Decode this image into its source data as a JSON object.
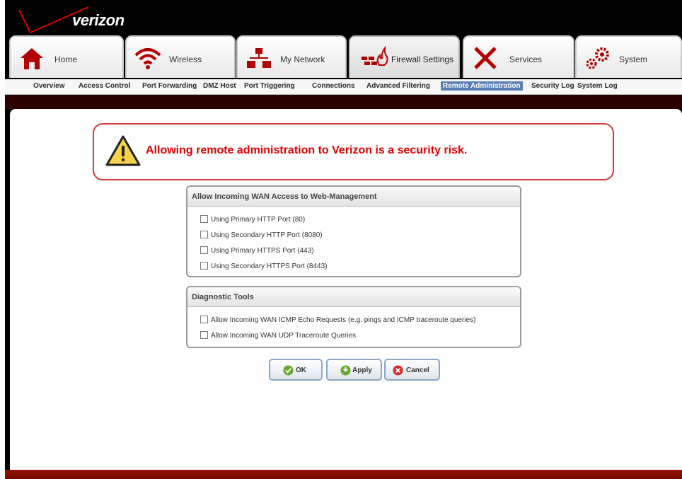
{
  "brand": {
    "logo_text": "verizon"
  },
  "tabs": [
    {
      "label": "Home",
      "icon": "home-icon"
    },
    {
      "label": "Wireless",
      "icon": "wifi-icon"
    },
    {
      "label": "My Network",
      "icon": "network-icon"
    },
    {
      "label": "Firewall Settings",
      "icon": "firewall-icon",
      "active": true
    },
    {
      "label": "Services",
      "icon": "tools-icon"
    },
    {
      "label": "System",
      "icon": "gears-icon"
    }
  ],
  "subnav": [
    {
      "label": "Overview"
    },
    {
      "label": "Access Control"
    },
    {
      "label": "Port Forwarding"
    },
    {
      "label": "DMZ Host"
    },
    {
      "label": "Port Triggering"
    },
    {
      "label": "Connections"
    },
    {
      "label": "Advanced Filtering"
    },
    {
      "label": "Remote Administration",
      "active": true
    },
    {
      "label": "Security Log"
    },
    {
      "label": "System Log"
    }
  ],
  "warning": {
    "icon": "warning-icon",
    "text": "Allowing remote administration to Verizon is a security risk."
  },
  "wan_access": {
    "title": "Allow Incoming WAN Access to Web-Management",
    "options": [
      {
        "label": "Using Primary HTTP Port (80)",
        "checked": false
      },
      {
        "label": "Using Secondary HTTP Port (8080)",
        "checked": false
      },
      {
        "label": "Using Primary HTTPS Port (443)",
        "checked": false
      },
      {
        "label": "Using Secondary HTTPS Port (8443)",
        "checked": false
      }
    ]
  },
  "diagnostics": {
    "title": "Diagnostic Tools",
    "options": [
      {
        "label": "Allow Incoming WAN ICMP Echo Requests (e.g. pings and ICMP traceroute queries)",
        "checked": false
      },
      {
        "label": "Allow Incoming WAN UDP Traceroute Queries",
        "checked": false
      }
    ]
  },
  "buttons": {
    "ok": "OK",
    "apply": "Apply",
    "cancel": "Cancel"
  },
  "colors": {
    "accent_red": "#e00000",
    "nav_active": "#5a7fb5",
    "button_border": "#8aa8c6"
  }
}
